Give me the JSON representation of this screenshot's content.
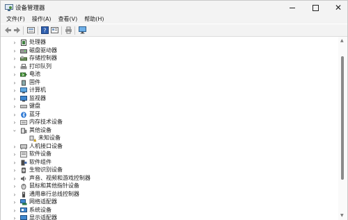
{
  "window": {
    "title": "设备管理器"
  },
  "menu": [
    "文件(F)",
    "操作(A)",
    "查看(V)",
    "帮助(H)"
  ],
  "toolbar_icons": [
    "back-arrow-icon",
    "forward-arrow-icon",
    "device-manager-icon",
    "list-view-icon",
    "help-icon",
    "properties-icon",
    "printer-icon",
    "monitor-icon"
  ],
  "tree": [
    {
      "label": "处理器",
      "icon": "processor-icon",
      "expanded": false
    },
    {
      "label": "磁盘驱动器",
      "icon": "disk-drive-icon",
      "expanded": false
    },
    {
      "label": "存储控制器",
      "icon": "storage-controller-icon",
      "expanded": false
    },
    {
      "label": "打印队列",
      "icon": "print-queue-icon",
      "expanded": false
    },
    {
      "label": "电池",
      "icon": "battery-icon",
      "expanded": false
    },
    {
      "label": "固件",
      "icon": "firmware-icon",
      "expanded": false
    },
    {
      "label": "计算机",
      "icon": "computer-icon",
      "expanded": false
    },
    {
      "label": "监视器",
      "icon": "monitor-icon",
      "expanded": false
    },
    {
      "label": "键盘",
      "icon": "keyboard-icon",
      "expanded": false
    },
    {
      "label": "蓝牙",
      "icon": "bluetooth-icon",
      "expanded": false
    },
    {
      "label": "内存技术设备",
      "icon": "memory-device-icon",
      "expanded": false
    },
    {
      "label": "其他设备",
      "icon": "other-devices-icon",
      "expanded": true,
      "children": [
        {
          "label": "未知设备",
          "icon": "unknown-device-warning-icon"
        }
      ]
    },
    {
      "label": "人机接口设备",
      "icon": "hid-icon",
      "expanded": false
    },
    {
      "label": "软件设备",
      "icon": "software-device-icon",
      "expanded": false
    },
    {
      "label": "软件组件",
      "icon": "software-component-icon",
      "expanded": false
    },
    {
      "label": "生物识别设备",
      "icon": "biometric-icon",
      "expanded": false
    },
    {
      "label": "声音、视频和游戏控制器",
      "icon": "sound-icon",
      "expanded": false
    },
    {
      "label": "鼠标和其他指针设备",
      "icon": "mouse-icon",
      "expanded": false
    },
    {
      "label": "通用串行总线控制器",
      "icon": "usb-icon",
      "expanded": false
    },
    {
      "label": "网络适配器",
      "icon": "network-adapter-icon",
      "expanded": false
    },
    {
      "label": "系统设备",
      "icon": "system-device-icon",
      "expanded": false
    },
    {
      "label": "显示适配器",
      "icon": "display-adapter-icon",
      "expanded": false
    }
  ]
}
